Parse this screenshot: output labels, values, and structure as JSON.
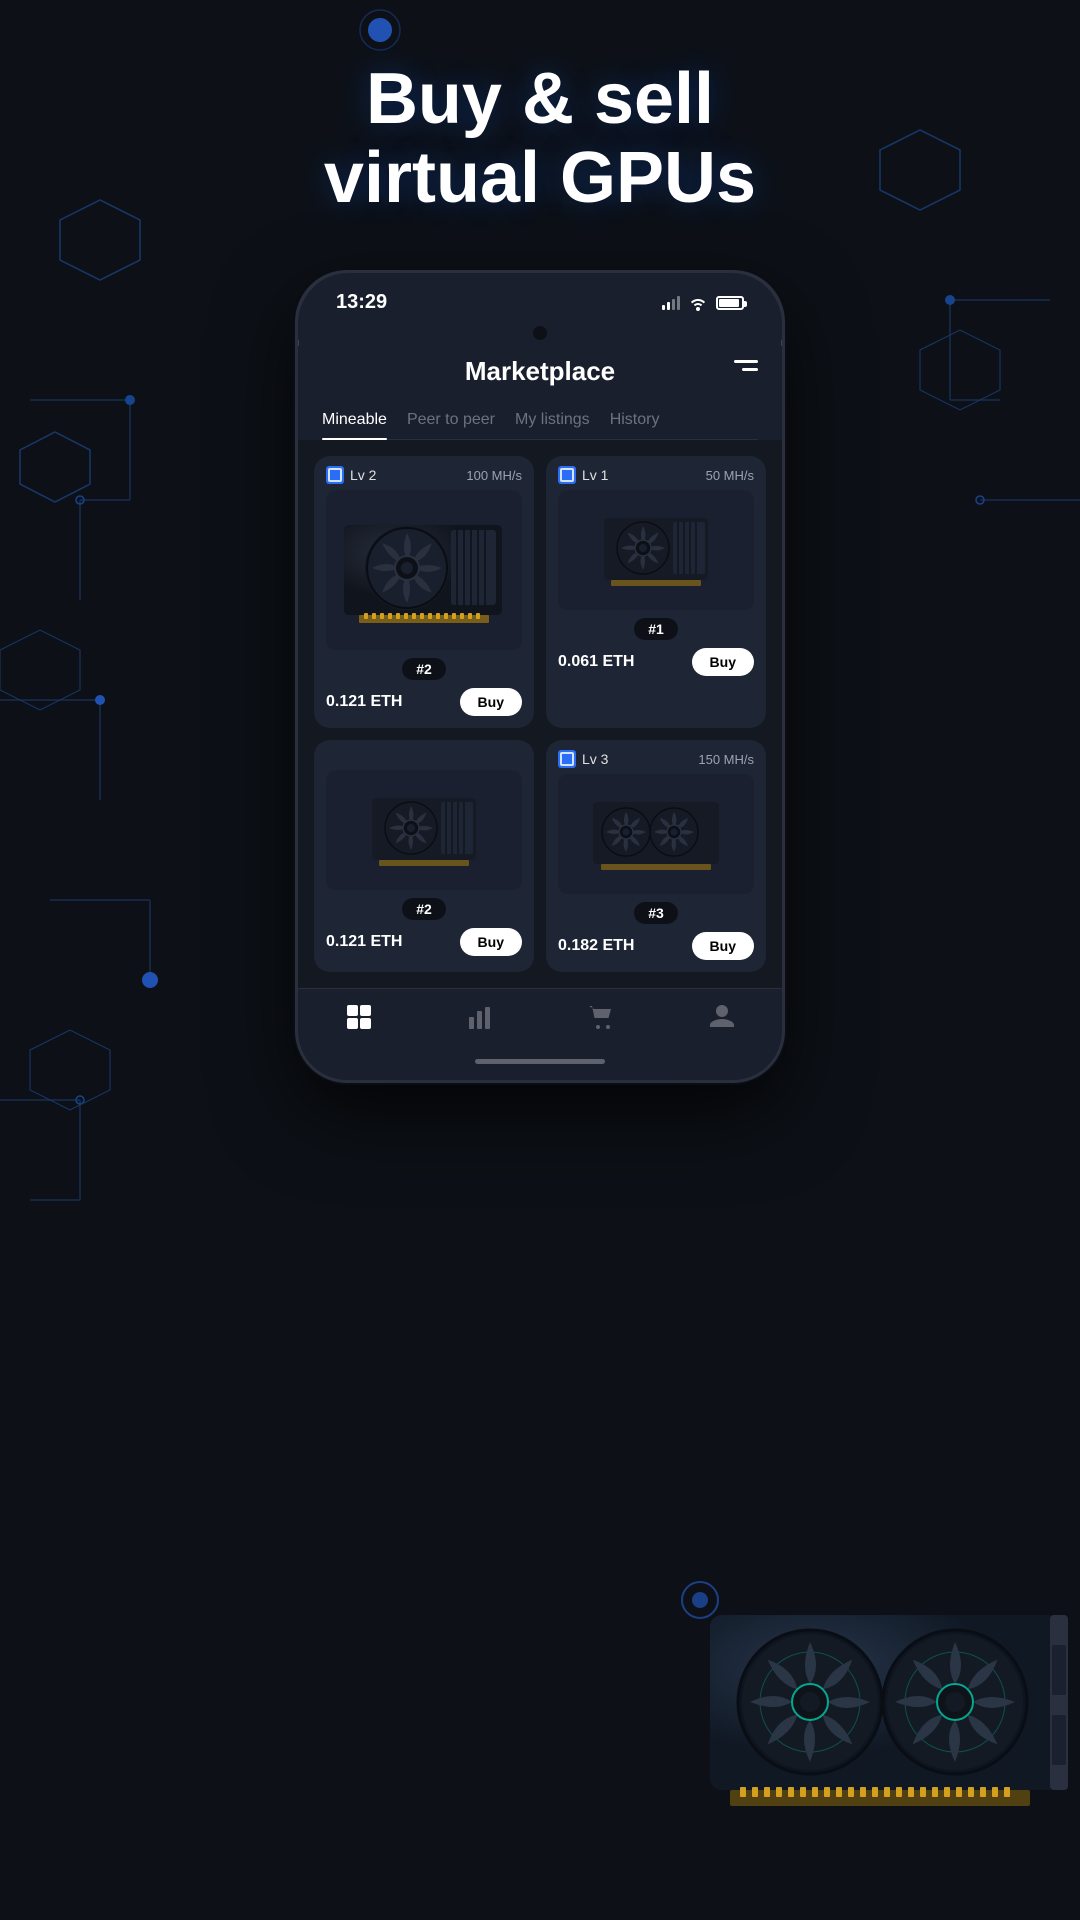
{
  "hero": {
    "title_line1": "Buy & sell",
    "title_line2": "virtual GPUs"
  },
  "phone": {
    "status_bar": {
      "time": "13:29"
    },
    "header": {
      "title": "Marketplace",
      "filter_label": "filter"
    },
    "tabs": [
      {
        "id": "mineable",
        "label": "Mineable",
        "active": true
      },
      {
        "id": "peer-to-peer",
        "label": "Peer to peer",
        "active": false
      },
      {
        "id": "my-listings",
        "label": "My listings",
        "active": false
      },
      {
        "id": "history",
        "label": "History",
        "active": false
      }
    ],
    "gpu_cards": [
      {
        "id": "card-1",
        "level": "Lv 2",
        "hashrate": "100 MH/s",
        "number": "#2",
        "price": "0.121 ETH",
        "buy_label": "Buy",
        "fans": 1,
        "size": "large"
      },
      {
        "id": "card-2",
        "level": "Lv 1",
        "hashrate": "50 MH/s",
        "number": "#1",
        "price": "0.061 ETH",
        "buy_label": "Buy",
        "fans": 1,
        "size": "small"
      },
      {
        "id": "card-3",
        "level": "",
        "hashrate": "",
        "number": "#2",
        "price": "0.121 ETH",
        "buy_label": "Buy",
        "fans": 1,
        "size": "small"
      },
      {
        "id": "card-4",
        "level": "Lv 3",
        "hashrate": "150 MH/s",
        "number": "#3",
        "price": "0.182 ETH",
        "buy_label": "Buy",
        "fans": 2,
        "size": "small"
      }
    ],
    "bottom_nav": [
      {
        "id": "home",
        "label": "",
        "active": true,
        "icon": "grid"
      },
      {
        "id": "stats",
        "label": "",
        "active": false,
        "icon": "bar-chart"
      },
      {
        "id": "cart",
        "label": "",
        "active": false,
        "icon": "cart"
      },
      {
        "id": "profile",
        "label": "",
        "active": false,
        "icon": "profile"
      }
    ]
  }
}
